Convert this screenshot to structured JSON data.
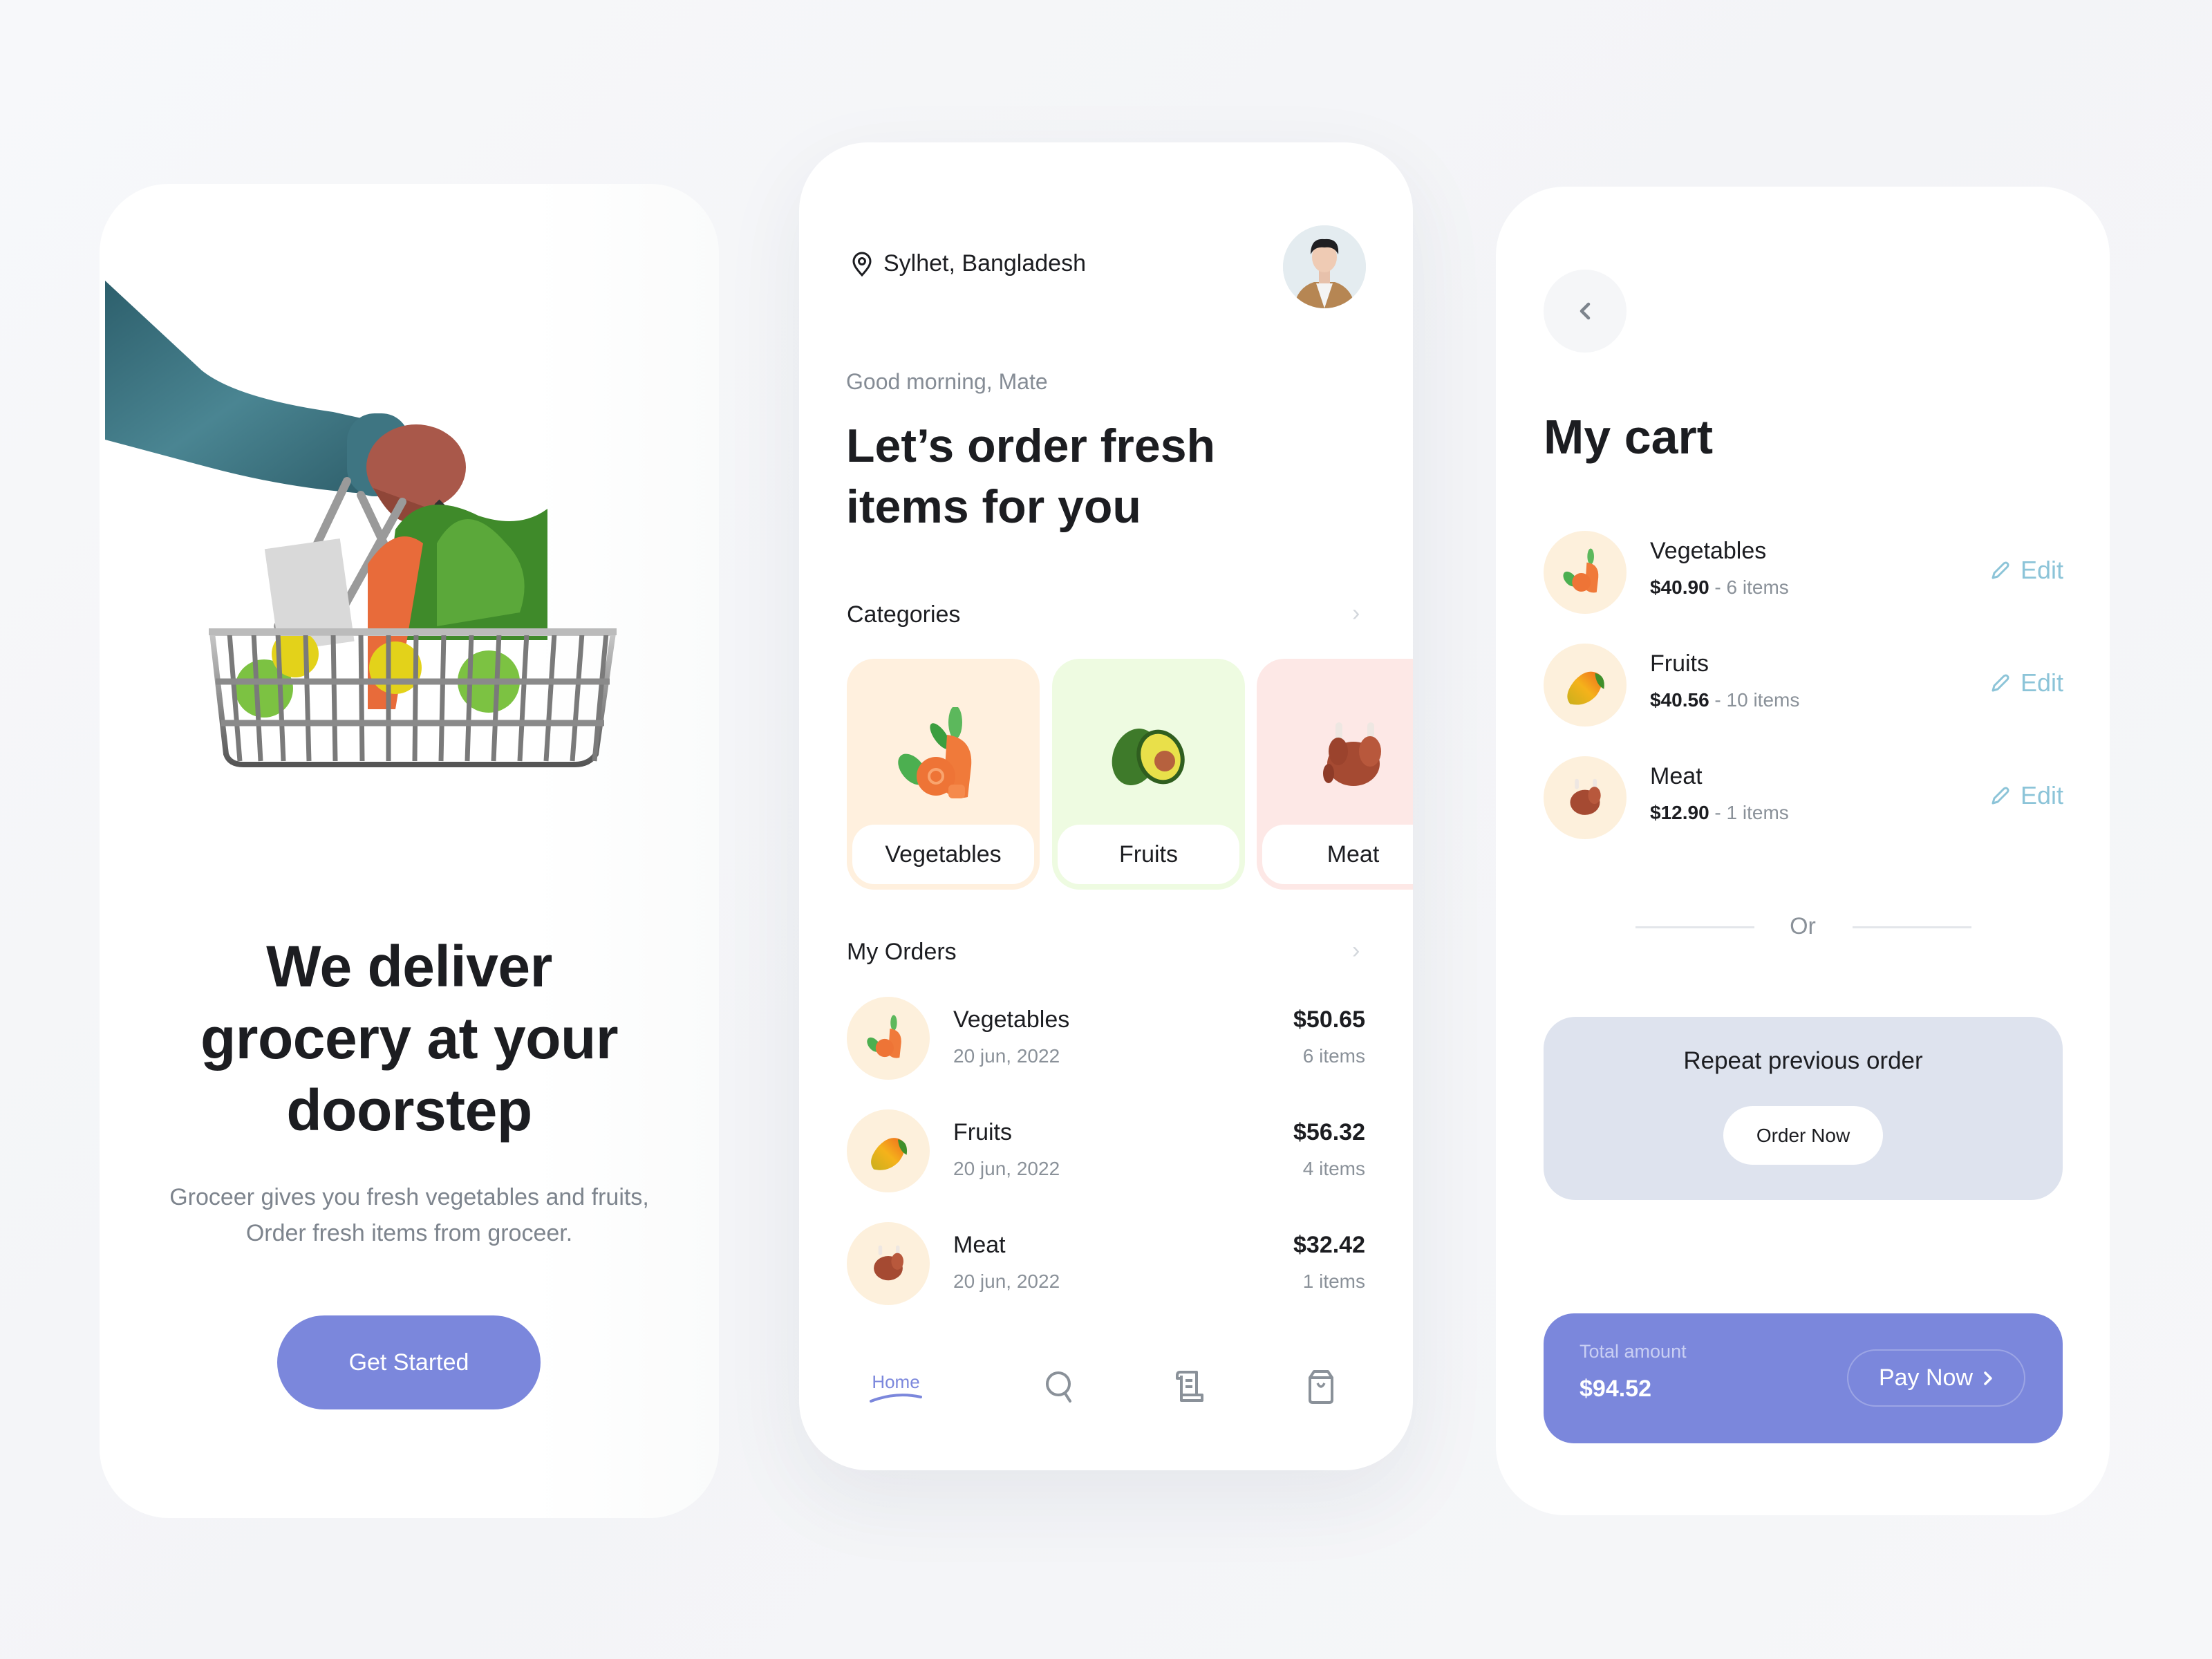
{
  "colors": {
    "accent": "#7b87dc",
    "edit": "#8cc4d8",
    "veg_card": "#fff0de",
    "fruit_card": "#eefbe1",
    "meat_card": "#fde8e6",
    "repeat_card": "#dee3ee"
  },
  "onboarding": {
    "headline": [
      "We deliver",
      "grocery at your",
      "doorstep"
    ],
    "subtitle": [
      "Groceer gives you fresh vegetables and fruits,",
      "Order fresh items from groceer."
    ],
    "cta_label": "Get Started"
  },
  "home": {
    "location": "Sylhet, Bangladesh",
    "greeting": "Good morning, Mate",
    "headline": [
      "Let’s order fresh",
      "items for you"
    ],
    "categories_title": "Categories",
    "categories": [
      {
        "label": "Vegetables",
        "icon": "carrot-icon"
      },
      {
        "label": "Fruits",
        "icon": "avocado-icon"
      },
      {
        "label": "Meat",
        "icon": "chicken-icon"
      }
    ],
    "orders_title": "My Orders",
    "orders": [
      {
        "name": "Vegetables",
        "date": "20 jun, 2022",
        "price": "$50.65",
        "count": "6 items",
        "icon": "carrot-icon"
      },
      {
        "name": "Fruits",
        "date": "20 jun, 2022",
        "price": "$56.32",
        "count": "4 items",
        "icon": "mango-icon"
      },
      {
        "name": "Meat",
        "date": "20 jun, 2022",
        "price": "$32.42",
        "count": "1 items",
        "icon": "chicken-icon"
      }
    ],
    "nav": [
      {
        "label": "Home",
        "icon": "home",
        "active": true
      },
      {
        "label": "",
        "icon": "search-icon"
      },
      {
        "label": "",
        "icon": "receipt-icon"
      },
      {
        "label": "",
        "icon": "shopping-bag-icon"
      }
    ]
  },
  "cart": {
    "title": "My cart",
    "items": [
      {
        "name": "Vegetables",
        "price": "$40.90",
        "count": "6 items",
        "edit": "Edit"
      },
      {
        "name": "Fruits",
        "price": "$40.56",
        "count": "10 items",
        "edit": "Edit"
      },
      {
        "name": "Meat",
        "price": "$12.90",
        "count": "1 items",
        "edit": "Edit"
      }
    ],
    "separator": "Or",
    "repeat_title": "Repeat previous order",
    "repeat_button": "Order Now",
    "total_label": "Total amount",
    "total_amount": "$94.52",
    "pay_button": "Pay Now"
  }
}
